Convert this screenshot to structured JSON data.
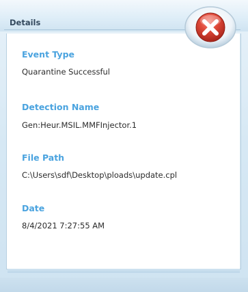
{
  "header": {
    "title": "Details"
  },
  "details": {
    "event_type_label": "Event Type",
    "event_type_value": "Quarantine Successful",
    "detection_name_label": "Detection Name",
    "detection_name_value": "Gen:Heur.MSIL.MMFInjector.1",
    "file_path_label": "File Path",
    "file_path_value": "C:\\Users\\sdf\\Desktop\\ploads\\update.cpl",
    "date_label": "Date",
    "date_value": "8/4/2021 7:27:55 AM"
  },
  "colors": {
    "label_accent": "#4aa3df",
    "close_button": "#d63b2e"
  },
  "icons": {
    "close": "close-icon"
  }
}
